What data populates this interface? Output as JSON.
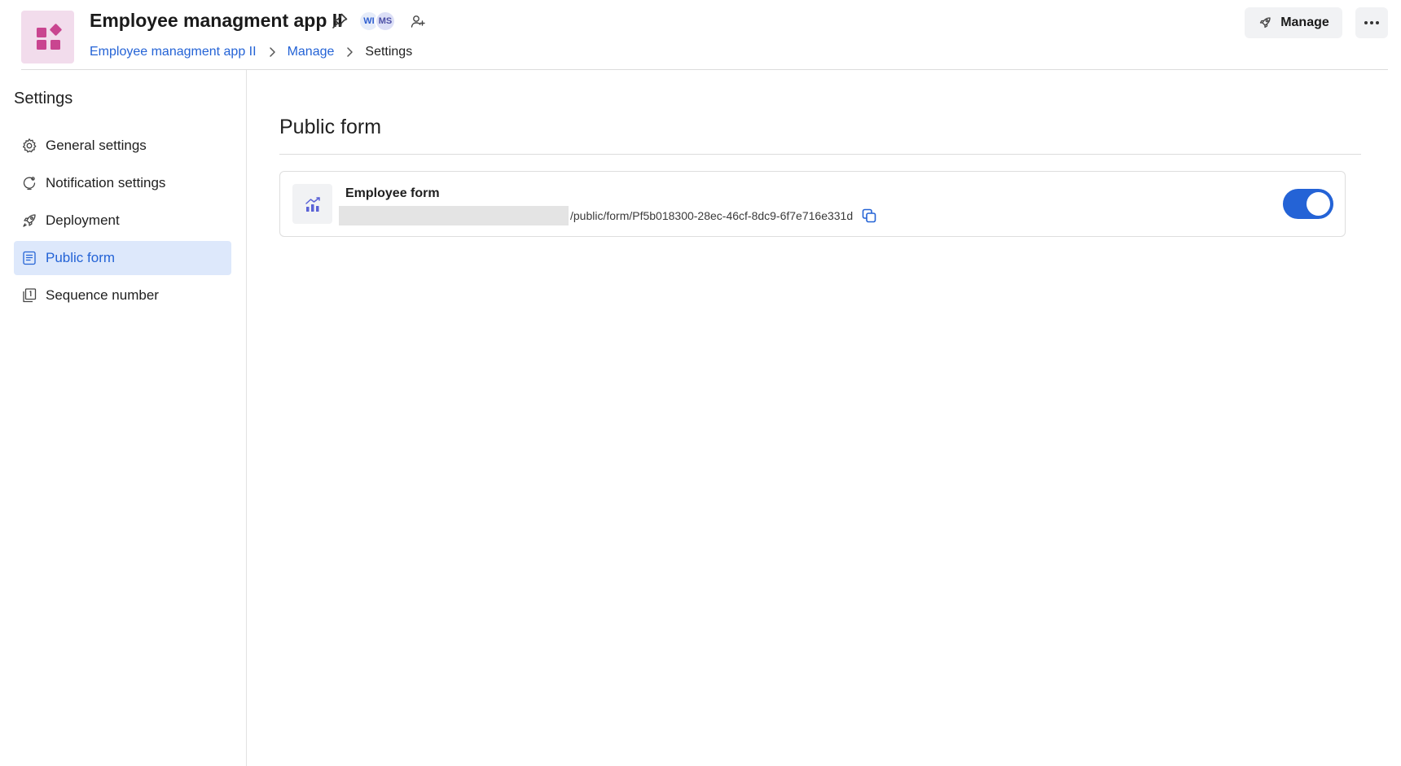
{
  "header": {
    "app_title": "Employee managment app II",
    "avatars": [
      {
        "initials": "WI"
      },
      {
        "initials": "MS"
      }
    ],
    "breadcrumb": {
      "items": [
        "Employee managment app II",
        "Manage"
      ],
      "current": "Settings"
    },
    "manage_label": "Manage"
  },
  "sidebar": {
    "title": "Settings",
    "items": [
      {
        "label": "General settings",
        "icon": "gear-icon"
      },
      {
        "label": "Notification settings",
        "icon": "bell-icon"
      },
      {
        "label": "Deployment",
        "icon": "rocket-icon"
      },
      {
        "label": "Public form",
        "icon": "form-icon",
        "active": true
      },
      {
        "label": "Sequence number",
        "icon": "sequence-number-icon"
      }
    ]
  },
  "main": {
    "title": "Public form",
    "forms": [
      {
        "name": "Employee form",
        "url_path": "/public/form/Pf5b018300-28ec-46cf-8dc9-6f7e716e331d",
        "enabled": true
      }
    ]
  },
  "colors": {
    "accent": "#2463d6",
    "app_icon_bg": "#f2dcec",
    "app_icon_fg": "#c94590",
    "active_nav_bg": "#dde8fb",
    "chart_icon": "#5a62d6"
  }
}
